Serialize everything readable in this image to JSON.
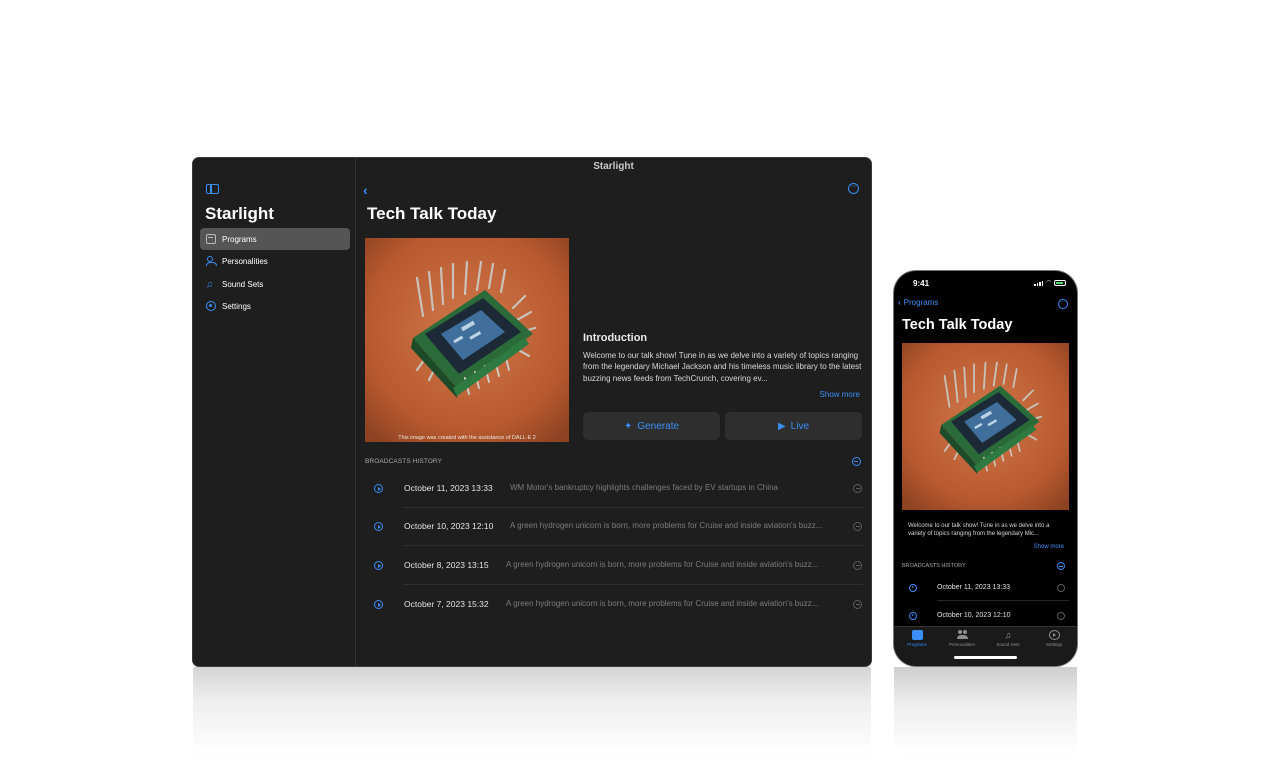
{
  "mac": {
    "window_title": "Starlight",
    "sidebar": {
      "app_title": "Starlight",
      "items": [
        {
          "label": "Programs",
          "icon": "radio-icon",
          "active": true
        },
        {
          "label": "Personalities",
          "icon": "people-icon",
          "active": false
        },
        {
          "label": "Sound Sets",
          "icon": "sound-icon",
          "active": false
        },
        {
          "label": "Settings",
          "icon": "gear-icon",
          "active": false
        }
      ]
    },
    "main": {
      "title": "Tech Talk Today",
      "cover_caption": "This image was created with the assistance of DALL·E 2",
      "intro_heading": "Introduction",
      "intro_text": "Welcome to our talk show! Tune in as we delve into a variety of topics ranging from the legendary Michael Jackson and his timeless music library to the latest buzzing news feeds from TechCrunch, covering ev...",
      "show_more": "Show more",
      "generate_label": "Generate",
      "live_label": "Live",
      "history_heading": "BROADCASTS HISTORY",
      "history": [
        {
          "date": "October 11, 2023  13:33",
          "desc": "WM Motor's bankruptcy highlights challenges faced by EV startups in China"
        },
        {
          "date": "October 10, 2023  12:10",
          "desc": "A green hydrogen unicorn is born, more problems for Cruise and inside aviation's buzz..."
        },
        {
          "date": "October 8, 2023  13:15",
          "desc": "A green hydrogen unicorn is born, more problems for Cruise and inside aviation's buzz..."
        },
        {
          "date": "October 7, 2023  15:32",
          "desc": "A green hydrogen unicorn is born, more problems for Cruise and inside aviation's buzz..."
        }
      ]
    }
  },
  "phone": {
    "time": "9:41",
    "back_label": "Programs",
    "title": "Tech Talk Today",
    "intro_text": "Welcome to our talk show! Tune in as we delve into a variety of topics ranging from the legendary Mic...",
    "show_more": "Show more",
    "history_heading": "BROADCASTS HISTORY",
    "history": [
      {
        "date": "October 11, 2023  13:33"
      },
      {
        "date": "October 10, 2023  12:10"
      }
    ],
    "tabs": [
      {
        "label": "Programs",
        "active": true
      },
      {
        "label": "Personalities",
        "active": false
      },
      {
        "label": "Sound Sets",
        "active": false
      },
      {
        "label": "Settings",
        "active": false
      }
    ]
  },
  "colors": {
    "accent": "#3a8ef6",
    "window_bg": "#1e1e1e",
    "button_bg": "#2e2e2e"
  }
}
